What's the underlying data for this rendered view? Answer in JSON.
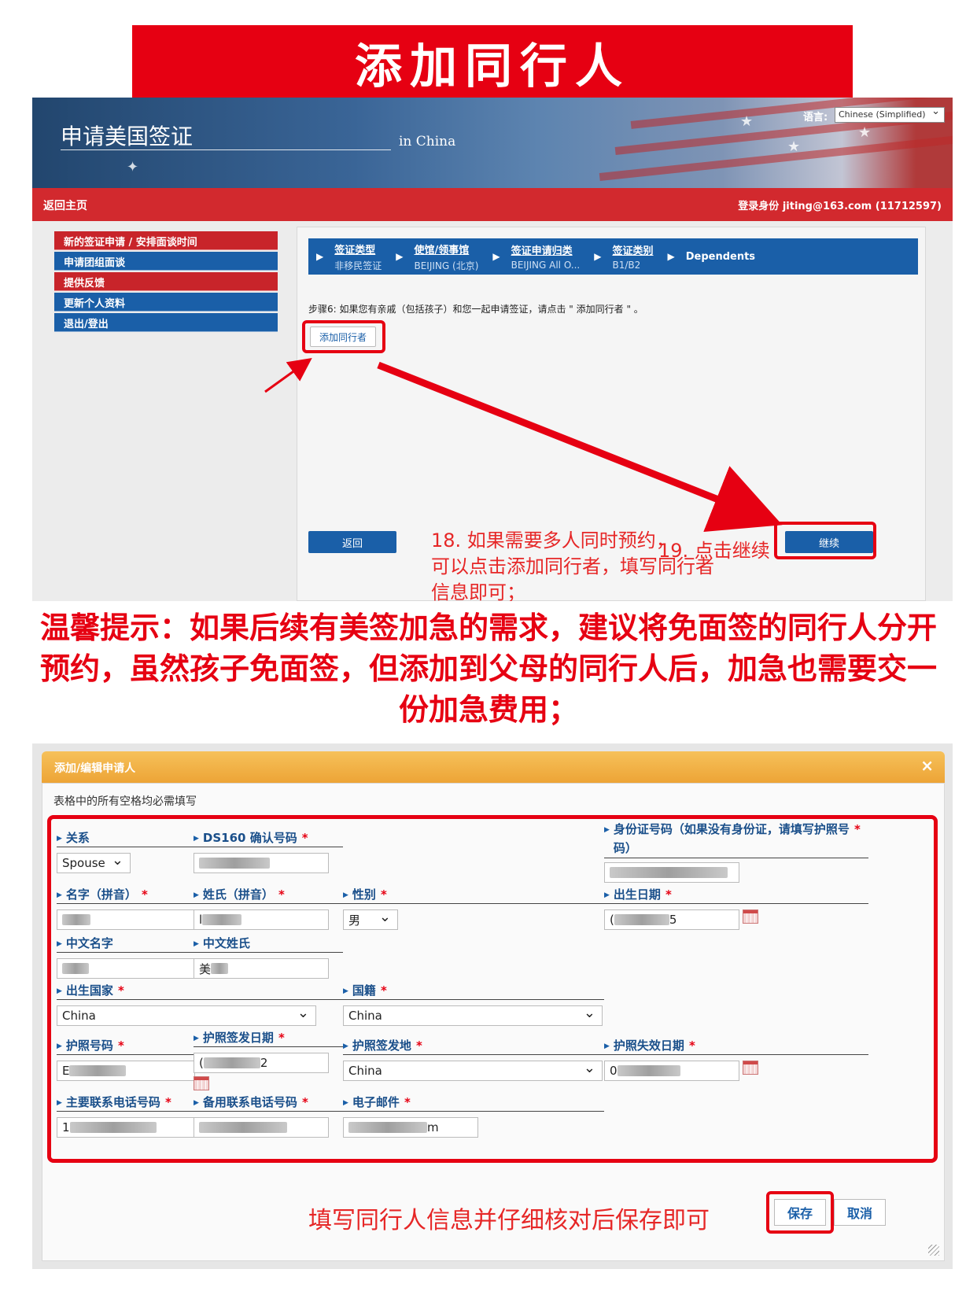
{
  "banner": {
    "title": "添加同行人"
  },
  "site": {
    "title": "申请美国签证",
    "subtitle": "in China",
    "language_label": "语言:",
    "language_value": "Chinese (Simplified)",
    "nav_home": "返回主页",
    "nav_login": "登录身份 jiting@163.com (11712597)"
  },
  "left_menu": [
    {
      "label": "新的签证申请 / 安排面谈时间"
    },
    {
      "label": "申请团组面谈"
    },
    {
      "label": "提供反馈"
    },
    {
      "label": "更新个人资料"
    },
    {
      "label": "退出/登出"
    }
  ],
  "breadcrumb": [
    {
      "label": "签证类型",
      "value": "非移民签证"
    },
    {
      "label": "使馆/领事馆",
      "value": "BEIJING (北京)"
    },
    {
      "label": "签证申请归类",
      "value": "BEIJING All O..."
    },
    {
      "label": "签证类别",
      "value": "B1/B2"
    },
    {
      "label": "Dependents"
    }
  ],
  "step": {
    "text": "步骤6: 如果您有亲戚（包括孩子）和您一起申请签证，请点击 \" 添加同行者 \" 。",
    "add_companion_label": "添加同行者",
    "back_label": "返回",
    "continue_label": "继续"
  },
  "notes": {
    "note18": "18. 如果需要多人同时预约，\n可以点击添加同行者，填写同行者\n信息即可；",
    "note19": "19. 点击继续",
    "tip": "温馨提示：如果后续有美签加急的需求，建议将免面签的同行人分开预约，虽然孩子免面签，但添加到父母的同行人后，加急也需要交一份加急费用；",
    "fill_note": "填写同行人信息并仔细核对后保存即可"
  },
  "dialog": {
    "title": "添加/编辑申请人",
    "close": "×",
    "required_note": "表格中的所有空格均必需填写",
    "save_label": "保存",
    "cancel_label": "取消",
    "required_mark": "*"
  },
  "form": {
    "relationship": {
      "label": "关系",
      "value": "Spouse"
    },
    "ds160": {
      "label": "DS160 确认号码"
    },
    "id_number": {
      "label": "身份证号码（如果没有身份证，请填写护照号\n码）"
    },
    "given_name": {
      "label": "名字（拼音）"
    },
    "surname": {
      "label": "姓氏（拼音）",
      "prefix": "l"
    },
    "gender": {
      "label": "性别",
      "value": "男"
    },
    "dob": {
      "label": "出生日期",
      "prefix": "(",
      "suffix": "5"
    },
    "cn_given": {
      "label": "中文名字"
    },
    "cn_surname": {
      "label": "中文姓氏",
      "prefix": "美"
    },
    "birth_country": {
      "label": "出生国家",
      "value": "China"
    },
    "nationality": {
      "label": "国籍",
      "value": "China"
    },
    "passport_no": {
      "label": "护照号码",
      "prefix": "E"
    },
    "passport_issue_date": {
      "label": "护照签发日期",
      "prefix": "(",
      "suffix": "2"
    },
    "passport_issue_place": {
      "label": "护照签发地",
      "value": "China"
    },
    "passport_expiry": {
      "label": "护照失效日期",
      "prefix": "0"
    },
    "primary_phone": {
      "label": "主要联系电话号码",
      "prefix": "1"
    },
    "alt_phone": {
      "label": "备用联系电话号码"
    },
    "email": {
      "label": "电子邮件",
      "suffix": "m"
    }
  }
}
